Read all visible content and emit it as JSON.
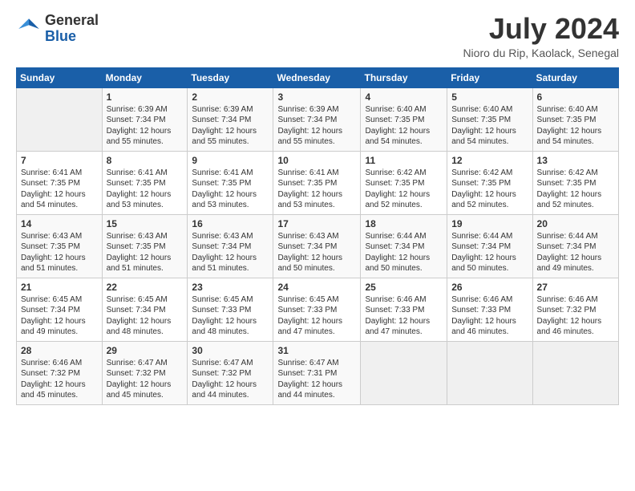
{
  "header": {
    "logo_general": "General",
    "logo_blue": "Blue",
    "month_title": "July 2024",
    "location": "Nioro du Rip, Kaolack, Senegal"
  },
  "weekdays": [
    "Sunday",
    "Monday",
    "Tuesday",
    "Wednesday",
    "Thursday",
    "Friday",
    "Saturday"
  ],
  "weeks": [
    [
      {
        "day": "",
        "sunrise": "",
        "sunset": "",
        "daylight": ""
      },
      {
        "day": "1",
        "sunrise": "Sunrise: 6:39 AM",
        "sunset": "Sunset: 7:34 PM",
        "daylight": "Daylight: 12 hours and 55 minutes."
      },
      {
        "day": "2",
        "sunrise": "Sunrise: 6:39 AM",
        "sunset": "Sunset: 7:34 PM",
        "daylight": "Daylight: 12 hours and 55 minutes."
      },
      {
        "day": "3",
        "sunrise": "Sunrise: 6:39 AM",
        "sunset": "Sunset: 7:34 PM",
        "daylight": "Daylight: 12 hours and 55 minutes."
      },
      {
        "day": "4",
        "sunrise": "Sunrise: 6:40 AM",
        "sunset": "Sunset: 7:35 PM",
        "daylight": "Daylight: 12 hours and 54 minutes."
      },
      {
        "day": "5",
        "sunrise": "Sunrise: 6:40 AM",
        "sunset": "Sunset: 7:35 PM",
        "daylight": "Daylight: 12 hours and 54 minutes."
      },
      {
        "day": "6",
        "sunrise": "Sunrise: 6:40 AM",
        "sunset": "Sunset: 7:35 PM",
        "daylight": "Daylight: 12 hours and 54 minutes."
      }
    ],
    [
      {
        "day": "7",
        "sunrise": "Sunrise: 6:41 AM",
        "sunset": "Sunset: 7:35 PM",
        "daylight": "Daylight: 12 hours and 54 minutes."
      },
      {
        "day": "8",
        "sunrise": "Sunrise: 6:41 AM",
        "sunset": "Sunset: 7:35 PM",
        "daylight": "Daylight: 12 hours and 53 minutes."
      },
      {
        "day": "9",
        "sunrise": "Sunrise: 6:41 AM",
        "sunset": "Sunset: 7:35 PM",
        "daylight": "Daylight: 12 hours and 53 minutes."
      },
      {
        "day": "10",
        "sunrise": "Sunrise: 6:41 AM",
        "sunset": "Sunset: 7:35 PM",
        "daylight": "Daylight: 12 hours and 53 minutes."
      },
      {
        "day": "11",
        "sunrise": "Sunrise: 6:42 AM",
        "sunset": "Sunset: 7:35 PM",
        "daylight": "Daylight: 12 hours and 52 minutes."
      },
      {
        "day": "12",
        "sunrise": "Sunrise: 6:42 AM",
        "sunset": "Sunset: 7:35 PM",
        "daylight": "Daylight: 12 hours and 52 minutes."
      },
      {
        "day": "13",
        "sunrise": "Sunrise: 6:42 AM",
        "sunset": "Sunset: 7:35 PM",
        "daylight": "Daylight: 12 hours and 52 minutes."
      }
    ],
    [
      {
        "day": "14",
        "sunrise": "Sunrise: 6:43 AM",
        "sunset": "Sunset: 7:35 PM",
        "daylight": "Daylight: 12 hours and 51 minutes."
      },
      {
        "day": "15",
        "sunrise": "Sunrise: 6:43 AM",
        "sunset": "Sunset: 7:35 PM",
        "daylight": "Daylight: 12 hours and 51 minutes."
      },
      {
        "day": "16",
        "sunrise": "Sunrise: 6:43 AM",
        "sunset": "Sunset: 7:34 PM",
        "daylight": "Daylight: 12 hours and 51 minutes."
      },
      {
        "day": "17",
        "sunrise": "Sunrise: 6:43 AM",
        "sunset": "Sunset: 7:34 PM",
        "daylight": "Daylight: 12 hours and 50 minutes."
      },
      {
        "day": "18",
        "sunrise": "Sunrise: 6:44 AM",
        "sunset": "Sunset: 7:34 PM",
        "daylight": "Daylight: 12 hours and 50 minutes."
      },
      {
        "day": "19",
        "sunrise": "Sunrise: 6:44 AM",
        "sunset": "Sunset: 7:34 PM",
        "daylight": "Daylight: 12 hours and 50 minutes."
      },
      {
        "day": "20",
        "sunrise": "Sunrise: 6:44 AM",
        "sunset": "Sunset: 7:34 PM",
        "daylight": "Daylight: 12 hours and 49 minutes."
      }
    ],
    [
      {
        "day": "21",
        "sunrise": "Sunrise: 6:45 AM",
        "sunset": "Sunset: 7:34 PM",
        "daylight": "Daylight: 12 hours and 49 minutes."
      },
      {
        "day": "22",
        "sunrise": "Sunrise: 6:45 AM",
        "sunset": "Sunset: 7:34 PM",
        "daylight": "Daylight: 12 hours and 48 minutes."
      },
      {
        "day": "23",
        "sunrise": "Sunrise: 6:45 AM",
        "sunset": "Sunset: 7:33 PM",
        "daylight": "Daylight: 12 hours and 48 minutes."
      },
      {
        "day": "24",
        "sunrise": "Sunrise: 6:45 AM",
        "sunset": "Sunset: 7:33 PM",
        "daylight": "Daylight: 12 hours and 47 minutes."
      },
      {
        "day": "25",
        "sunrise": "Sunrise: 6:46 AM",
        "sunset": "Sunset: 7:33 PM",
        "daylight": "Daylight: 12 hours and 47 minutes."
      },
      {
        "day": "26",
        "sunrise": "Sunrise: 6:46 AM",
        "sunset": "Sunset: 7:33 PM",
        "daylight": "Daylight: 12 hours and 46 minutes."
      },
      {
        "day": "27",
        "sunrise": "Sunrise: 6:46 AM",
        "sunset": "Sunset: 7:32 PM",
        "daylight": "Daylight: 12 hours and 46 minutes."
      }
    ],
    [
      {
        "day": "28",
        "sunrise": "Sunrise: 6:46 AM",
        "sunset": "Sunset: 7:32 PM",
        "daylight": "Daylight: 12 hours and 45 minutes."
      },
      {
        "day": "29",
        "sunrise": "Sunrise: 6:47 AM",
        "sunset": "Sunset: 7:32 PM",
        "daylight": "Daylight: 12 hours and 45 minutes."
      },
      {
        "day": "30",
        "sunrise": "Sunrise: 6:47 AM",
        "sunset": "Sunset: 7:32 PM",
        "daylight": "Daylight: 12 hours and 44 minutes."
      },
      {
        "day": "31",
        "sunrise": "Sunrise: 6:47 AM",
        "sunset": "Sunset: 7:31 PM",
        "daylight": "Daylight: 12 hours and 44 minutes."
      },
      {
        "day": "",
        "sunrise": "",
        "sunset": "",
        "daylight": ""
      },
      {
        "day": "",
        "sunrise": "",
        "sunset": "",
        "daylight": ""
      },
      {
        "day": "",
        "sunrise": "",
        "sunset": "",
        "daylight": ""
      }
    ]
  ]
}
